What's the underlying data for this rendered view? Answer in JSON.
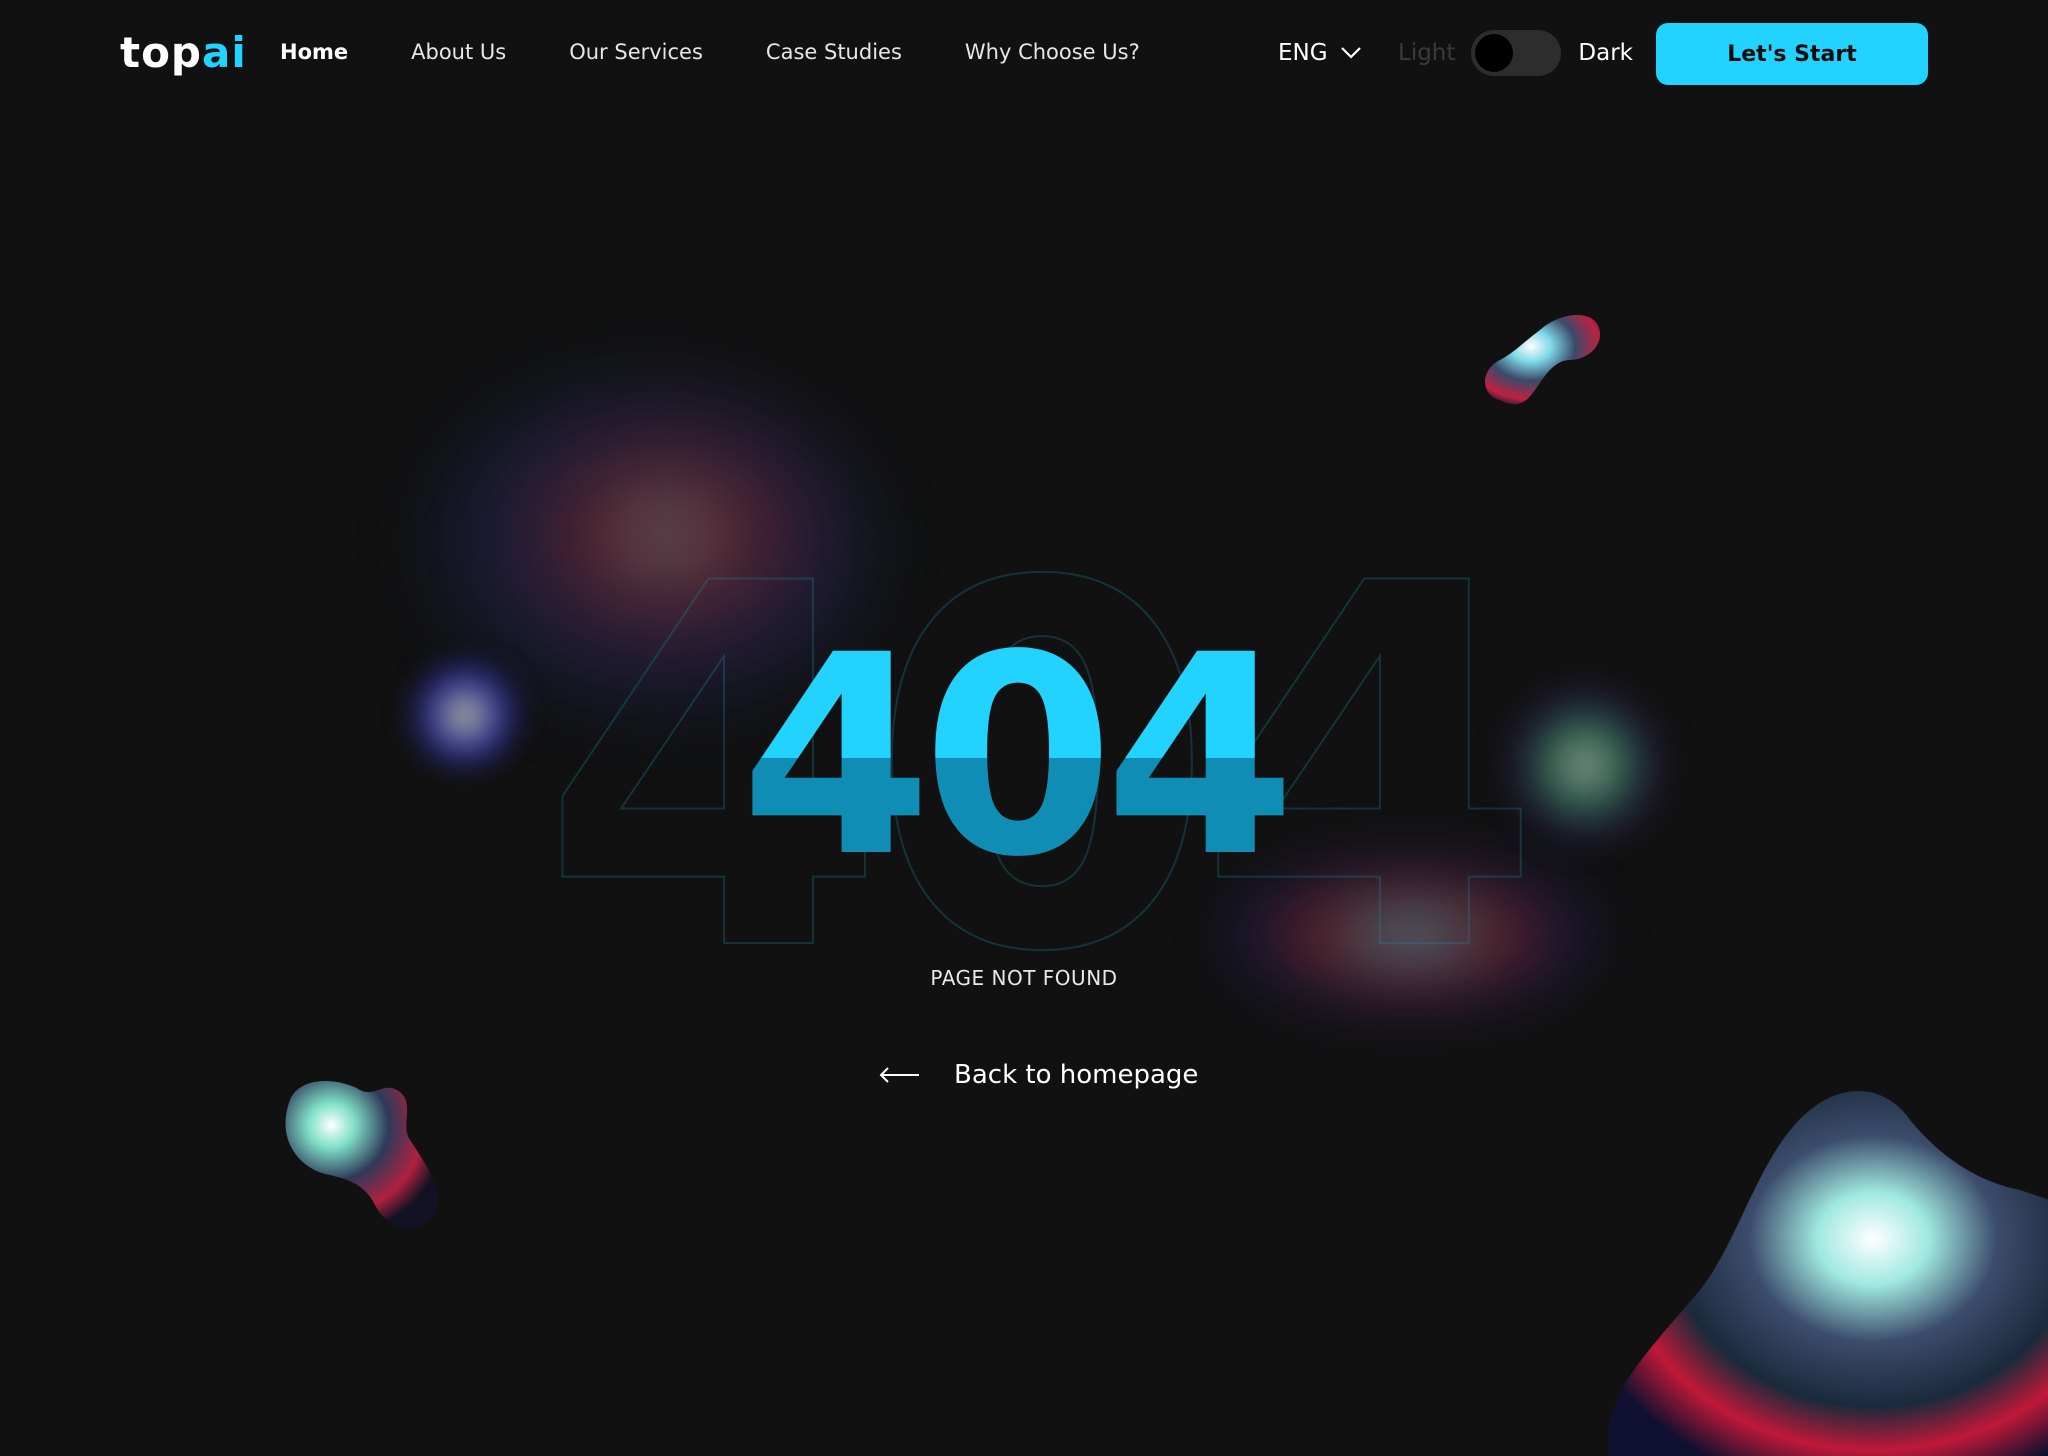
{
  "brand": {
    "logo_part1": "top",
    "logo_part2": "ai"
  },
  "nav": {
    "items": [
      {
        "label": "Home",
        "active": true
      },
      {
        "label": "About Us",
        "active": false
      },
      {
        "label": "Our Services",
        "active": false
      },
      {
        "label": "Case Studies",
        "active": false
      },
      {
        "label": "Why Choose Us?",
        "active": false
      }
    ]
  },
  "language": {
    "selected": "ENG",
    "icon": "chevron-down-icon"
  },
  "theme": {
    "light_label": "Light",
    "dark_label": "Dark",
    "selected": "Dark"
  },
  "cta": {
    "label": "Let's Start"
  },
  "error": {
    "code_outline": "404",
    "code": "404",
    "message": "PAGE NOT FOUND",
    "back_label": "Back to homepage",
    "back_icon": "arrow-left-icon"
  },
  "colors": {
    "background": "#111111",
    "accent": "#22d3ff",
    "accent_dark": "#0f8db5"
  }
}
